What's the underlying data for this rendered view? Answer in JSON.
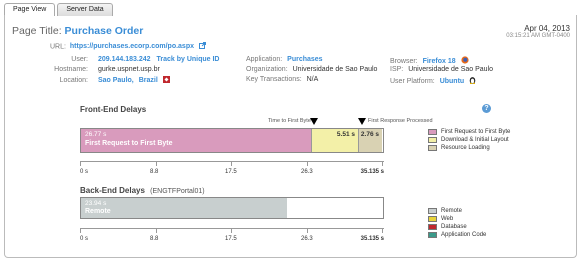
{
  "tabs": [
    {
      "label": "Page View",
      "active": true
    },
    {
      "label": "Server Data",
      "active": false
    }
  ],
  "header": {
    "title_label": "Page Title:",
    "title_value": "Purchase Order",
    "date": "Apr 04, 2013",
    "time": "03:15:21 AM GMT-0400"
  },
  "info": {
    "url_label": "URL:",
    "url_value": "https://purchases.ecorp.com/po.aspx",
    "user_label": "User:",
    "user_value": "209.144.183.242",
    "track_label": "Track by Unique ID",
    "hostname_label": "Hostname:",
    "hostname_value": "gurke.uspnet.usp.br",
    "location_label": "Location:",
    "location_city": "Sao Paulo,",
    "location_country": "Brazil",
    "application_label": "Application:",
    "application_value": "Purchases",
    "organization_label": "Organization:",
    "organization_value": "Universidade de Sao Paulo",
    "key_tx_label": "Key Transactions:",
    "key_tx_value": "N/A",
    "browser_label": "Browser:",
    "browser_value": "Firefox 18",
    "isp_label": "ISP:",
    "isp_value": "Universidade de Sao Paulo",
    "platform_label": "User Platform:",
    "platform_value": "Ubuntu"
  },
  "frontend": {
    "title": "Front-End Delays",
    "help": "?",
    "marker1_label": "Time to First Byte",
    "marker2_label": "First Response Processed",
    "segments": [
      {
        "name": "First Request to First Byte",
        "value_label": "26.77 s",
        "value": 26.77,
        "color": "#d99bbd"
      },
      {
        "name": "Download & Initial Layout",
        "value_label": "5.51 s",
        "value": 5.51,
        "color": "#f3f0a8"
      },
      {
        "name": "Resource Loading",
        "value_label": "2.76 s",
        "value": 2.76,
        "color": "#d9d2b3"
      }
    ],
    "ticks": [
      "0 s",
      "8.8",
      "17.5",
      "26.3",
      "35.135 s"
    ],
    "legend": [
      {
        "label": "First Request to First Byte",
        "color": "#d99bbd"
      },
      {
        "label": "Download & Initial Layout",
        "color": "#f3f0a8"
      },
      {
        "label": "Resource Loading",
        "color": "#d9d2b3"
      }
    ]
  },
  "backend": {
    "title": "Back-End Delays",
    "subtitle": "(ENGTFPortal01)",
    "segment": {
      "name": "Remote",
      "value_label": "23.94 s",
      "value": 23.94,
      "color": "#c8cfcf"
    },
    "ticks": [
      "0 s",
      "8.8",
      "17.5",
      "26.3",
      "35.135 s"
    ],
    "legend": [
      {
        "label": "Remote",
        "color": "#c8cfcf"
      },
      {
        "label": "Web",
        "color": "#e8d43a"
      },
      {
        "label": "Database",
        "color": "#c0282e"
      },
      {
        "label": "Application Code",
        "color": "#3a9a8a"
      }
    ]
  },
  "scale_max": 35.135
}
